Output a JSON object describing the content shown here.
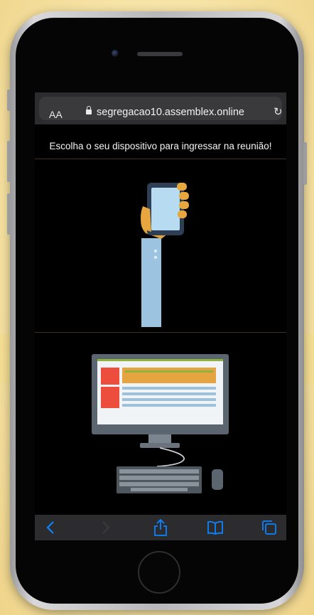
{
  "browser": {
    "text_size_label": "AA",
    "url": "segregacao10.assemblex.online"
  },
  "page": {
    "prompt": "Escolha o seu dispositivo para ingressar na reunião!"
  },
  "devices": [
    {
      "name": "mobile",
      "icon": "smartphone-in-hand-icon"
    },
    {
      "name": "desktop",
      "icon": "desktop-computer-icon"
    }
  ],
  "toolbar": {
    "icons": [
      "back-arrow-icon",
      "forward-arrow-icon",
      "share-icon",
      "bookmarks-icon",
      "tabs-icon"
    ]
  },
  "colors": {
    "toolbar_icon_active": "#0a84ff",
    "toolbar_icon_disabled": "#3a3a3c",
    "background": "#f6e3a6"
  }
}
